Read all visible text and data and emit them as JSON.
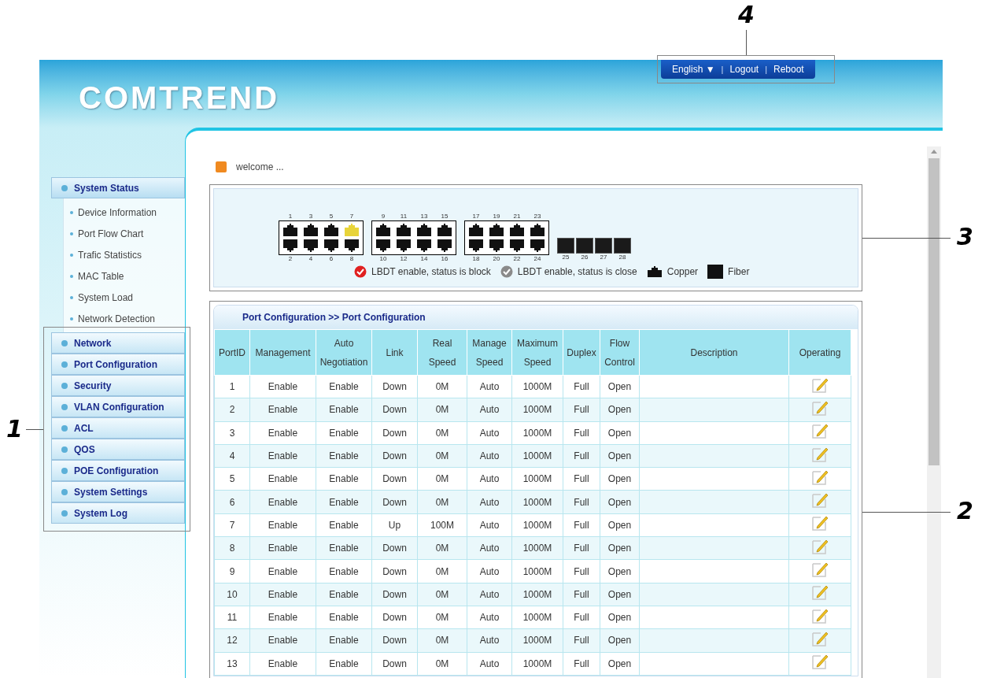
{
  "header": {
    "logo": "COMTREND",
    "links": [
      {
        "kind": "link",
        "text": "English ▼"
      },
      {
        "kind": "separator",
        "text": "|"
      },
      {
        "kind": "link",
        "text": "Logout"
      },
      {
        "kind": "separator",
        "text": "|"
      },
      {
        "kind": "link",
        "text": "Reboot"
      }
    ]
  },
  "sidebar": {
    "items": [
      {
        "label": "System Status",
        "expanded": true,
        "children": [
          "Device Information",
          "Port Flow Chart",
          "Trafic Statistics",
          "MAC Table",
          "System Load",
          "Network Detection"
        ]
      },
      {
        "label": "Network",
        "expanded": false
      },
      {
        "label": "Port Configuration",
        "expanded": false
      },
      {
        "label": "Security",
        "expanded": false
      },
      {
        "label": "VLAN Configuration",
        "expanded": false
      },
      {
        "label": "ACL",
        "expanded": false
      },
      {
        "label": "QOS",
        "expanded": false
      },
      {
        "label": "POE Configuration",
        "expanded": false
      },
      {
        "label": "System Settings",
        "expanded": false
      },
      {
        "label": "System Log",
        "expanded": false
      }
    ]
  },
  "welcome": "welcome ...",
  "switch_panel": {
    "groups": [
      {
        "kind": "copper",
        "columns": [
          {
            "top": {
              "label": "1",
              "up": false
            },
            "bottom": {
              "label": "2",
              "up": false
            }
          },
          {
            "top": {
              "label": "3",
              "up": false
            },
            "bottom": {
              "label": "4",
              "up": false
            }
          },
          {
            "top": {
              "label": "5",
              "up": false
            },
            "bottom": {
              "label": "6",
              "up": false
            }
          },
          {
            "top": {
              "label": "7",
              "up": true
            },
            "bottom": {
              "label": "8",
              "up": false
            }
          }
        ]
      },
      {
        "kind": "copper",
        "columns": [
          {
            "top": {
              "label": "9",
              "up": false
            },
            "bottom": {
              "label": "10",
              "up": false
            }
          },
          {
            "top": {
              "label": "11",
              "up": false
            },
            "bottom": {
              "label": "12",
              "up": false
            }
          },
          {
            "top": {
              "label": "13",
              "up": false
            },
            "bottom": {
              "label": "14",
              "up": false
            }
          },
          {
            "top": {
              "label": "15",
              "up": false
            },
            "bottom": {
              "label": "16",
              "up": false
            }
          }
        ]
      },
      {
        "kind": "copper",
        "columns": [
          {
            "top": {
              "label": "17",
              "up": false
            },
            "bottom": {
              "label": "18",
              "up": false
            }
          },
          {
            "top": {
              "label": "19",
              "up": false
            },
            "bottom": {
              "label": "20",
              "up": false
            }
          },
          {
            "top": {
              "label": "21",
              "up": false
            },
            "bottom": {
              "label": "22",
              "up": false
            }
          },
          {
            "top": {
              "label": "23",
              "up": false
            },
            "bottom": {
              "label": "24",
              "up": false
            }
          }
        ]
      },
      {
        "kind": "fiber",
        "ports": [
          {
            "label": "25",
            "up": false
          },
          {
            "label": "26",
            "up": false
          },
          {
            "label": "27",
            "up": false
          },
          {
            "label": "28",
            "up": false
          }
        ]
      }
    ],
    "legend": [
      {
        "kind": "block",
        "text": "LBDT enable, status is block"
      },
      {
        "kind": "close",
        "text": "LBDT enable, status is close"
      },
      {
        "kind": "copper",
        "text": "Copper"
      },
      {
        "kind": "fiber",
        "text": "Fiber"
      }
    ]
  },
  "table": {
    "title": "Port Configuration >> Port Configuration",
    "columns": [
      "PortID",
      "Management",
      "Auto Negotiation",
      "Link",
      "Real Speed",
      "Manage Speed",
      "Maximum Speed",
      "Duplex",
      "Flow Control",
      "Description",
      "Operating"
    ],
    "rows": [
      [
        "1",
        "Enable",
        "Enable",
        "Down",
        "0M",
        "Auto",
        "1000M",
        "Full",
        "Open"
      ],
      [
        "2",
        "Enable",
        "Enable",
        "Down",
        "0M",
        "Auto",
        "1000M",
        "Full",
        "Open"
      ],
      [
        "3",
        "Enable",
        "Enable",
        "Down",
        "0M",
        "Auto",
        "1000M",
        "Full",
        "Open"
      ],
      [
        "4",
        "Enable",
        "Enable",
        "Down",
        "0M",
        "Auto",
        "1000M",
        "Full",
        "Open"
      ],
      [
        "5",
        "Enable",
        "Enable",
        "Down",
        "0M",
        "Auto",
        "1000M",
        "Full",
        "Open"
      ],
      [
        "6",
        "Enable",
        "Enable",
        "Down",
        "0M",
        "Auto",
        "1000M",
        "Full",
        "Open"
      ],
      [
        "7",
        "Enable",
        "Enable",
        "Up",
        "100M",
        "Auto",
        "1000M",
        "Full",
        "Open"
      ],
      [
        "8",
        "Enable",
        "Enable",
        "Down",
        "0M",
        "Auto",
        "1000M",
        "Full",
        "Open"
      ],
      [
        "9",
        "Enable",
        "Enable",
        "Down",
        "0M",
        "Auto",
        "1000M",
        "Full",
        "Open"
      ],
      [
        "10",
        "Enable",
        "Enable",
        "Down",
        "0M",
        "Auto",
        "1000M",
        "Full",
        "Open"
      ],
      [
        "11",
        "Enable",
        "Enable",
        "Down",
        "0M",
        "Auto",
        "1000M",
        "Full",
        "Open"
      ],
      [
        "12",
        "Enable",
        "Enable",
        "Down",
        "0M",
        "Auto",
        "1000M",
        "Full",
        "Open"
      ],
      [
        "13",
        "Enable",
        "Enable",
        "Down",
        "0M",
        "Auto",
        "1000M",
        "Full",
        "Open"
      ]
    ]
  },
  "callouts": [
    "1",
    "2",
    "3",
    "4"
  ]
}
